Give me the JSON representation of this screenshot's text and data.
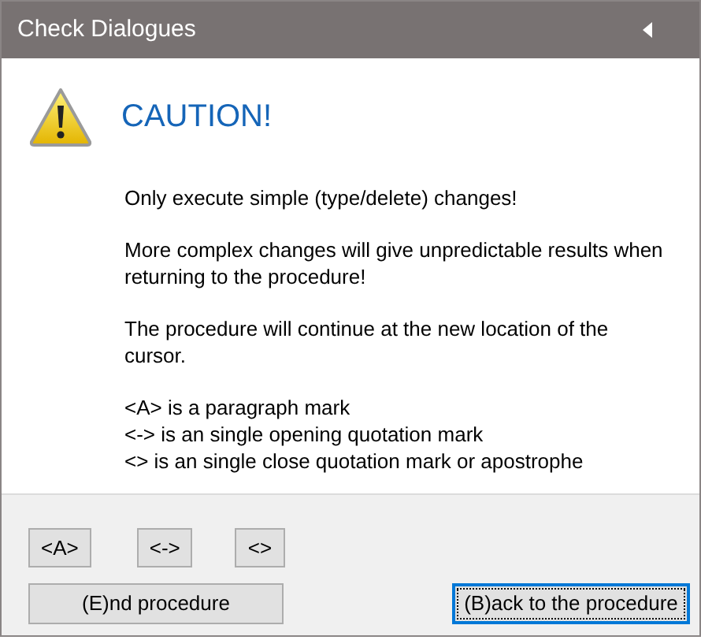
{
  "window": {
    "title": "Check Dialogues"
  },
  "heading": "CAUTION!",
  "paragraphs": [
    "Only execute simple (type/delete) changes!",
    "More complex changes will give unpredictable results when returning to the procedure!",
    "The procedure will continue at the new location of the cursor."
  ],
  "legend": [
    "<A> is a paragraph mark",
    "<-> is an single opening quotation mark",
    "<> is an single close quotation mark or apostrophe"
  ],
  "insert_buttons": [
    "<A>",
    "<->",
    "<>"
  ],
  "action_buttons": [
    {
      "label": "(E)nd procedure",
      "focused": false
    },
    {
      "label": "(B)ack to the procedure",
      "focused": true
    }
  ]
}
